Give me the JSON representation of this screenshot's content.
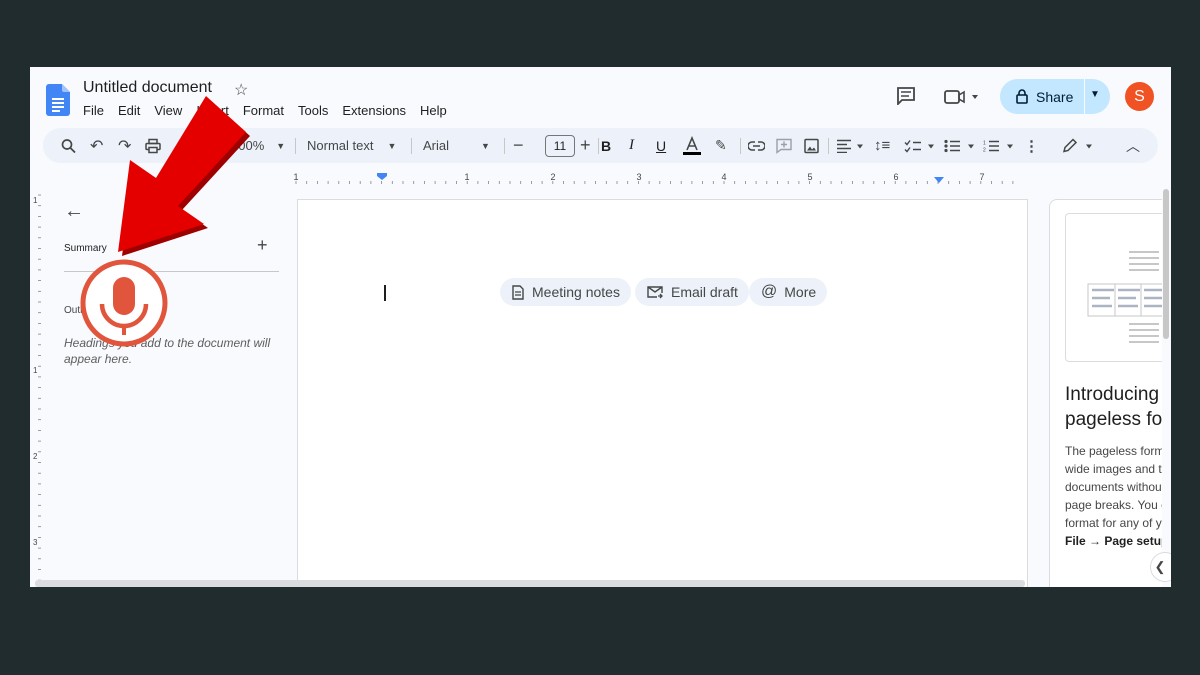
{
  "app": {
    "title": "Untitled document"
  },
  "menu": [
    "File",
    "Edit",
    "View",
    "Insert",
    "Format",
    "Tools",
    "Extensions",
    "Help"
  ],
  "header": {
    "share_label": "Share",
    "avatar_initial": "S"
  },
  "toolbar": {
    "zoom": "100%",
    "style": "Normal text",
    "font": "Arial",
    "font_size": "11"
  },
  "ruler": {
    "numbers": [
      "1",
      "1",
      "2",
      "3",
      "4",
      "5",
      "6",
      "7"
    ]
  },
  "vruler": {
    "numbers": [
      "1",
      "1",
      "2",
      "3"
    ]
  },
  "outline_panel": {
    "summary_label": "Summary",
    "outline_label": "Outline",
    "hint": "Headings you add to the document will appear here."
  },
  "chips": [
    {
      "label": "Meeting notes",
      "icon": "document-icon"
    },
    {
      "label": "Email draft",
      "icon": "email-icon"
    },
    {
      "label": "More",
      "icon": "at-sign-icon"
    }
  ],
  "side_panel": {
    "title": "Introducing pageless format",
    "lines": [
      "The pageless format supports",
      "wide images and tables, and",
      "documents without",
      "page breaks. You can change the",
      "format for any of your documents in"
    ],
    "path_label": "File → Page setup"
  },
  "overlay": {
    "arrow_color": "#e50000",
    "mic_color": "#e0553c"
  },
  "colors": {
    "share_bg": "#c2e7ff",
    "avatar": "#f05223",
    "docs_blue": "#4285f4"
  }
}
